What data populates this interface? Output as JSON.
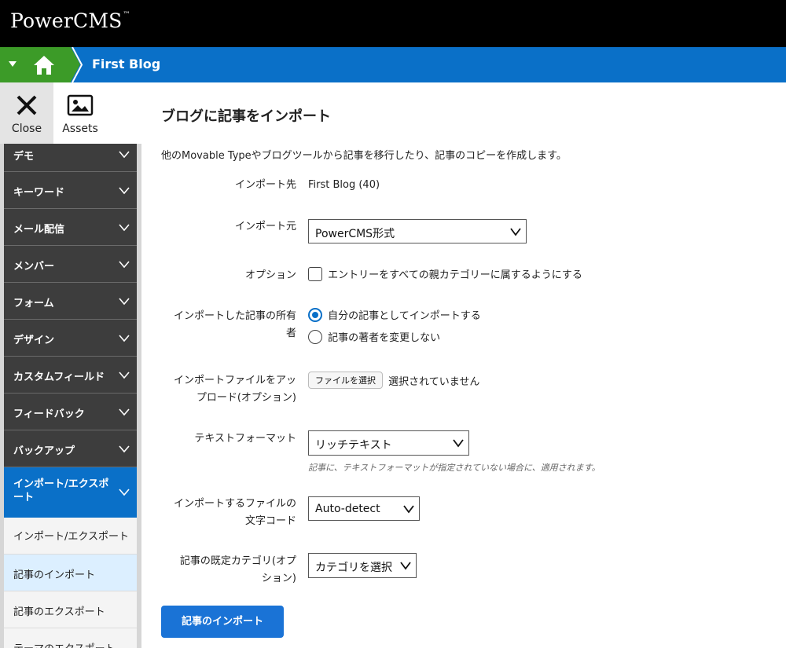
{
  "app": {
    "brand": "PowerCMS",
    "trademark": "™"
  },
  "blogbar": {
    "blog_name": "First Blog"
  },
  "tools": {
    "close_label": "Close",
    "assets_label": "Assets"
  },
  "sidebar": {
    "items": [
      {
        "label": "デモ"
      },
      {
        "label": "キーワード"
      },
      {
        "label": "メール配信"
      },
      {
        "label": "メンバー"
      },
      {
        "label": "フォーム"
      },
      {
        "label": "デザイン"
      },
      {
        "label": "カスタムフィールド"
      },
      {
        "label": "フィードバック"
      },
      {
        "label": "バックアップ"
      },
      {
        "label": "インポート/エクスポート"
      }
    ],
    "sub_items": [
      {
        "label": "インポート/エクスポート"
      },
      {
        "label": "記事のインポート"
      },
      {
        "label": "記事のエクスポート"
      },
      {
        "label": "テーマのエクスポート"
      }
    ]
  },
  "main": {
    "title": "ブログに記事をインポート",
    "description": "他のMovable Typeやブログツールから記事を移行したり、記事のコピーを作成します。",
    "import_to": {
      "label": "インポート先",
      "value": "First Blog (40)"
    },
    "import_from": {
      "label": "インポート元",
      "value": "PowerCMS形式"
    },
    "options": {
      "label": "オプション",
      "checkbox_label": "エントリーをすべての親カテゴリーに属するようにする",
      "checked": false
    },
    "owner": {
      "label_line1": "インポートした記事の所有",
      "label_line2": "者",
      "radio1": "自分の記事としてインポートする",
      "radio2": "記事の著者を変更しない",
      "selected": 1
    },
    "upload": {
      "label_line1": "インポートファイルをアッ",
      "label_line2": "プロード(オプション)",
      "button": "ファイルを選択",
      "status": "選択されていません"
    },
    "text_format": {
      "label": "テキストフォーマット",
      "value": "リッチテキスト",
      "hint": "記事に、テキストフォーマットが指定されていない場合に、適用されます。"
    },
    "encoding": {
      "label_line1": "インポートするファイルの",
      "label_line2": "文字コード",
      "value": "Auto-detect"
    },
    "category": {
      "label_line1": "記事の既定カテゴリ(オプ",
      "label_line2": "ション)",
      "value": "カテゴリを選択"
    },
    "submit": "記事のインポート"
  },
  "colors": {
    "brand_bar": "#000000",
    "blog_bar": "#0a70c8",
    "home": "#3c9b28",
    "sidebar_item": "#3d3d3d",
    "primary_button": "#1a73d6"
  }
}
